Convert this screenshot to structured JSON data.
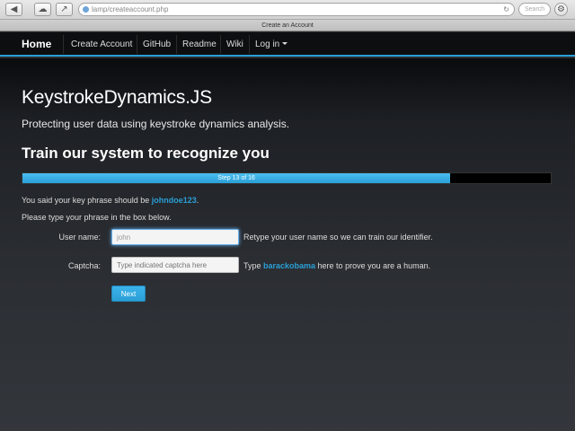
{
  "browser": {
    "url": "lamp/createaccount.php",
    "search_placeholder": "Search",
    "tab_title": "Create an Account"
  },
  "navbar": {
    "brand": "Home",
    "items": [
      "Create Account",
      "GitHub",
      "Readme",
      "Wiki",
      "Log in"
    ]
  },
  "page": {
    "title": "KeystrokeDynamics.JS",
    "subtitle": "Protecting user data using keystroke dynamics analysis.",
    "section_title": "Train our system to recognize you"
  },
  "progress": {
    "label": "Step 13 of 16",
    "step": 13,
    "total": 16,
    "fraction": 0.81
  },
  "instructions": {
    "key_phrase_prefix": "You said your key phrase should be ",
    "key_phrase": "johndoe123",
    "key_phrase_suffix": ".",
    "type_instruction": "Please type your phrase in the box below."
  },
  "form": {
    "username_label": "User name:",
    "username_value": "john",
    "username_help": "Retype your user name so we can train our identifier.",
    "captcha_label": "Captcha:",
    "captcha_placeholder": "Type indicated captcha here",
    "captcha_help_prefix": "Type ",
    "captcha_word": "barackobama",
    "captcha_help_suffix": " here to prove you are a human.",
    "next_label": "Next"
  },
  "colors": {
    "accent": "#2a9fd6",
    "navbar_bg": "#0d0e10"
  }
}
